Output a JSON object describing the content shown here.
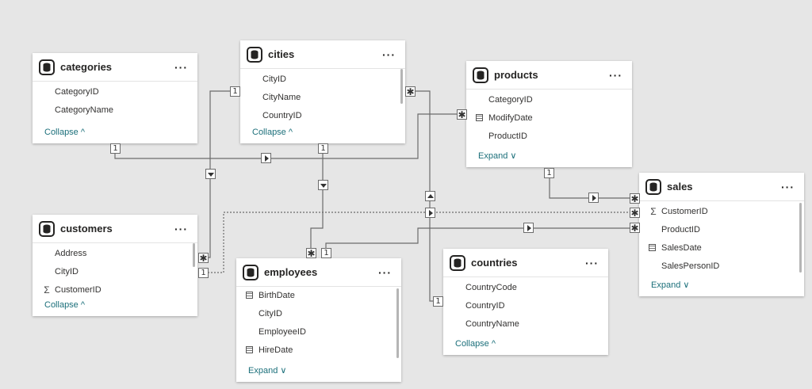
{
  "theme": {
    "background": "#e6e6e6",
    "card": "#ffffff",
    "line": "#6b6b6b",
    "link": "#1b6f7a"
  },
  "more_label": "···",
  "icons": {
    "table": "table-icon",
    "sum": "sigma-icon",
    "date": "calendar-icon"
  },
  "tables": {
    "categories": {
      "title": "categories",
      "fields": [
        "CategoryID",
        "CategoryName"
      ],
      "toggle": "Collapse ^"
    },
    "cities": {
      "title": "cities",
      "fields": [
        "CityID",
        "CityName",
        "CountryID"
      ],
      "toggle": "Collapse ^"
    },
    "products": {
      "title": "products",
      "fields": [
        "CategoryID",
        "ModifyDate",
        "ProductID"
      ],
      "toggle": "Expand ∨"
    },
    "customers": {
      "title": "customers",
      "fields": [
        "Address",
        "CityID",
        "CustomerID"
      ],
      "toggle": "Collapse ^"
    },
    "employees": {
      "title": "employees",
      "fields": [
        "BirthDate",
        "CityID",
        "EmployeeID",
        "HireDate"
      ],
      "toggle": "Expand ∨"
    },
    "countries": {
      "title": "countries",
      "fields": [
        "CountryCode",
        "CountryID",
        "CountryName"
      ],
      "toggle": "Collapse ^"
    },
    "sales": {
      "title": "sales",
      "fields": [
        "CustomerID",
        "ProductID",
        "SalesDate",
        "SalesPersonID"
      ],
      "toggle": "Expand ∨"
    }
  },
  "cardinality": {
    "one": "1",
    "many": "✱"
  }
}
